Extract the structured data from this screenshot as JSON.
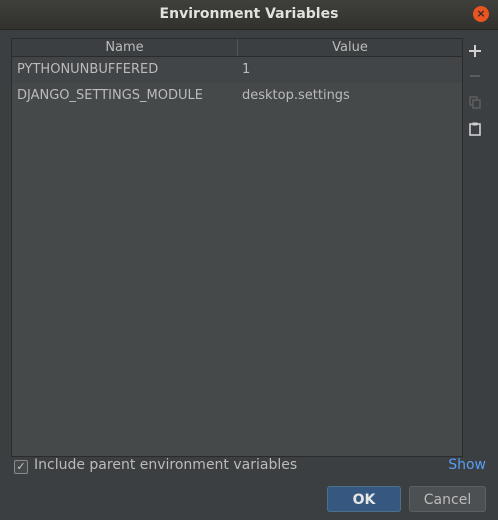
{
  "window": {
    "title": "Environment Variables",
    "close_glyph": "×"
  },
  "table": {
    "columns": [
      "Name",
      "Value"
    ],
    "rows": [
      {
        "name": "PYTHONUNBUFFERED",
        "value": "1"
      },
      {
        "name": "DJANGO_SETTINGS_MODULE",
        "value": "desktop.settings"
      }
    ]
  },
  "toolbar": {
    "add_icon": "plus-icon",
    "remove_icon": "minus-icon",
    "copy_icon": "copy-icon",
    "paste_icon": "paste-icon"
  },
  "footer": {
    "include_parent_label": "Include parent environment variables",
    "include_parent_checked": true,
    "show_link": "Show",
    "ok_label": "OK",
    "cancel_label": "Cancel"
  },
  "colors": {
    "background": "#3c3f41",
    "accent_ok": "#365880",
    "link": "#589df6",
    "close_button": "#e95420"
  }
}
